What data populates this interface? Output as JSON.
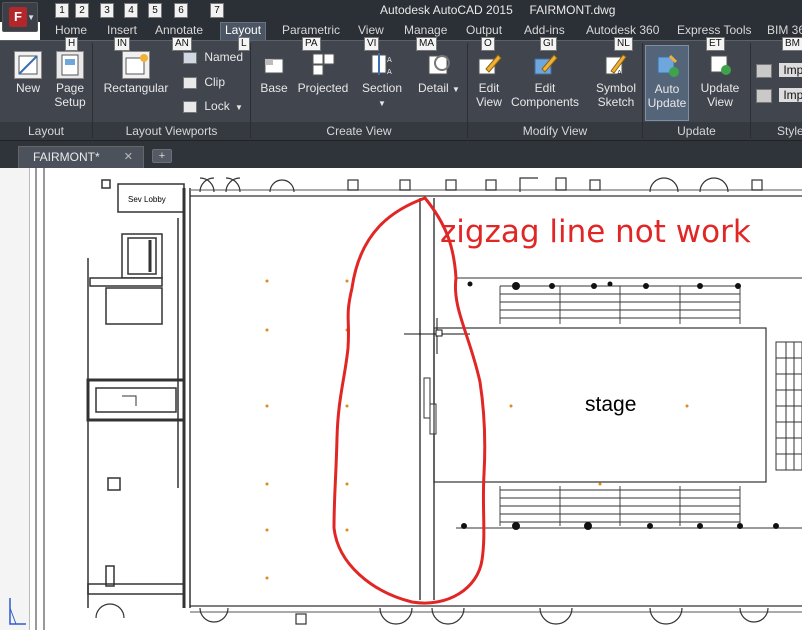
{
  "window": {
    "app_name": "Autodesk AutoCAD 2015",
    "file_name": "FAIRMONT.dwg",
    "app_button_letter": "F",
    "quick_access_keytips": [
      "1",
      "2",
      "3",
      "4",
      "5",
      "6",
      "7"
    ]
  },
  "ribbon_tabs": [
    {
      "label": "Home",
      "keytip": "H"
    },
    {
      "label": "Insert",
      "keytip": "IN"
    },
    {
      "label": "Annotate",
      "keytip": "AN"
    },
    {
      "label": "Layout",
      "keytip": "L",
      "active": true
    },
    {
      "label": "Parametric",
      "keytip": "PA"
    },
    {
      "label": "View",
      "keytip": "VI"
    },
    {
      "label": "Manage",
      "keytip": "MA"
    },
    {
      "label": "Output",
      "keytip": "O"
    },
    {
      "label": "Add-ins",
      "keytip": "GI"
    },
    {
      "label": "Autodesk 360",
      "keytip": "NL"
    },
    {
      "label": "Express Tools",
      "keytip": "ET"
    },
    {
      "label": "BIM 36",
      "keytip": "BM"
    }
  ],
  "ribbon_panels": {
    "layout": {
      "title": "Layout",
      "new_label": "New",
      "page_setup_label_1": "Page",
      "page_setup_label_2": "Setup"
    },
    "layout_viewports": {
      "title": "Layout Viewports",
      "rectangular_label": "Rectangular",
      "named_label": "Named",
      "clip_label": "Clip",
      "lock_label": "Lock"
    },
    "create_view": {
      "title": "Create View",
      "base_label": "Base",
      "projected_label": "Projected",
      "section_label": "Section",
      "detail_label": "Detail"
    },
    "modify_view": {
      "title": "Modify View",
      "edit_view_label_1": "Edit",
      "edit_view_label_2": "View",
      "edit_components_label_1": "Edit",
      "edit_components_label_2": "Components",
      "symbol_sketch_label_1": "Symbol",
      "symbol_sketch_label_2": "Sketch"
    },
    "update": {
      "title": "Update",
      "auto_update_label_1": "Auto",
      "auto_update_label_2": "Update",
      "update_view_label_1": "Update",
      "update_view_label_2": "View"
    },
    "styles": {
      "title": "Style",
      "import_label_1": "Imp",
      "import_label_2": "Imp"
    }
  },
  "document_tab": {
    "label": "FAIRMONT*",
    "close_glyph": "✕",
    "new_tab_glyph": "+"
  },
  "drawing": {
    "annotation_text": "zigzag line not work",
    "annotation_color": "#e12626",
    "stage_label": "stage",
    "room_label": "Sev Lobby"
  },
  "colors": {
    "ribbon_bg": "#40454e",
    "title_bg": "#2b2f36",
    "highlight_red": "#e12626"
  }
}
